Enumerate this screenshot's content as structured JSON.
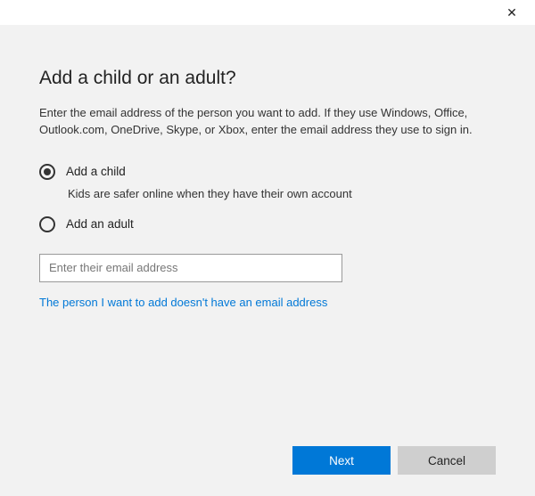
{
  "header": {
    "close_icon": "✕"
  },
  "main": {
    "title": "Add a child or an adult?",
    "description": "Enter the email address of the person you want to add. If they use Windows, Office, Outlook.com, OneDrive, Skype, or Xbox, enter the email address they use to sign in.",
    "options": {
      "child": {
        "label": "Add a child",
        "hint": "Kids are safer online when they have their own account",
        "selected": true
      },
      "adult": {
        "label": "Add an adult",
        "selected": false
      }
    },
    "email": {
      "value": "",
      "placeholder": "Enter their email address"
    },
    "no_email_link": "The person I want to add doesn't have an email address"
  },
  "footer": {
    "next_label": "Next",
    "cancel_label": "Cancel"
  }
}
